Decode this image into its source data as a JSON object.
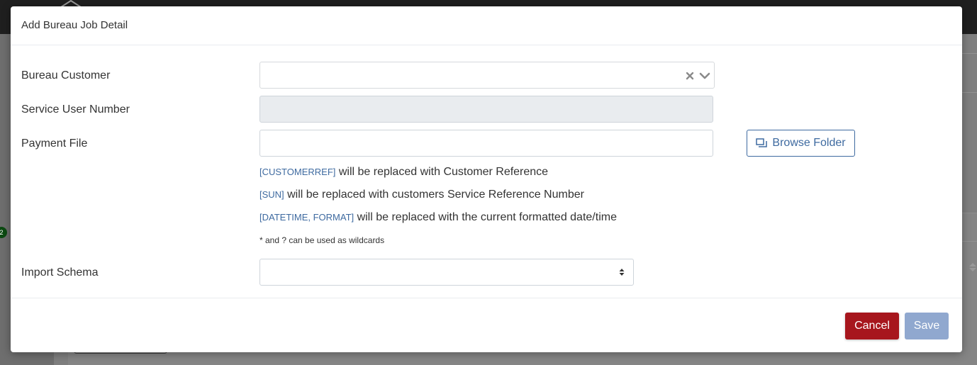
{
  "modal": {
    "title": "Add Bureau Job Detail"
  },
  "form": {
    "bureau_customer": {
      "label": "Bureau Customer",
      "value": "",
      "clear_icon": "close-icon",
      "dropdown_icon": "chevron-down-icon"
    },
    "service_user_number": {
      "label": "Service User Number",
      "value": "",
      "disabled": true
    },
    "payment_file": {
      "label": "Payment File",
      "value": "",
      "browse_label": "Browse Folder",
      "browse_icon": "folders-icon"
    },
    "hints": [
      {
        "token": "[CUSTOMERREF]",
        "text": " will be replaced with Customer Reference"
      },
      {
        "token": "[SUN]",
        "text": " will be replaced with customers Service Reference Number"
      },
      {
        "token": "[DATETIME, FORMAT]",
        "text": " will be replaced with the current formatted date/time"
      }
    ],
    "wildcard_note": "* and ? can be used as wildcards",
    "import_schema": {
      "label": "Import Schema",
      "value": "",
      "icon": "sort-arrows-icon"
    }
  },
  "footer": {
    "cancel_label": "Cancel",
    "save_label": "Save"
  },
  "background": {
    "badge_text": "2"
  },
  "colors": {
    "accent": "#3e6aa0",
    "cancel": "#a7161d",
    "save_disabled": "#90a8cf",
    "disabled_input": "#e9ecef"
  }
}
